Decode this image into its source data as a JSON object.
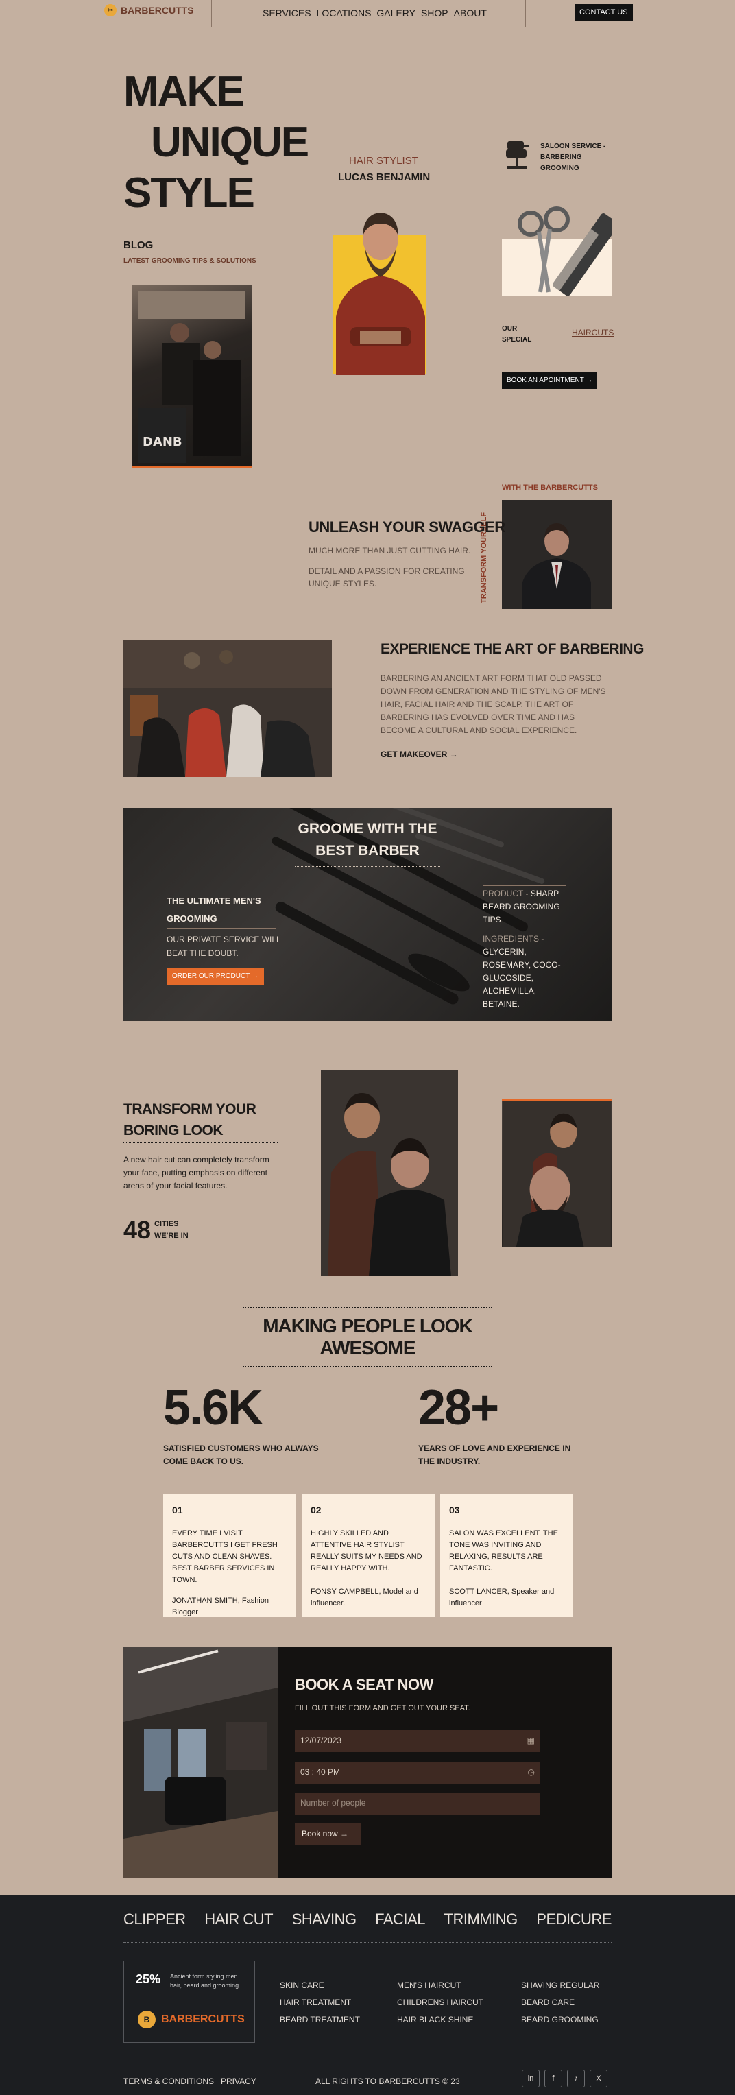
{
  "nav": {
    "brand": "BARBERCUTTS",
    "links": [
      "SERVICES",
      "LOCATIONS",
      "GALERY",
      "SHOP",
      "ABOUT"
    ],
    "contact": "CONTACT US"
  },
  "hero": {
    "title_lines": [
      "MAKE",
      "UNIQUE",
      "STYLE"
    ],
    "blog_title": "BLOG",
    "blog_sub": "LATEST GROOMING TIPS & SOLUTIONS",
    "stylist_label": "HAIR STYLIST",
    "stylist_name": "LUCAS BENJAMIN",
    "service_text": [
      "SALOON SERVICE -",
      "BARBERING",
      "GROOMING"
    ],
    "our_special": [
      "OUR",
      "SPECIAL"
    ],
    "haircuts_link": "HAIRCUTS",
    "book_button": "BOOK AN APOINTMENT"
  },
  "swagger": {
    "tag": "WITH THE BARBERCUTTS",
    "vertical": "TRANSFORM YOURSELF",
    "title": "UNLEASH YOUR SWAGGER",
    "p1": "MUCH MORE THAN JUST CUTTING HAIR.",
    "p2": "DETAIL AND A PASSION FOR CREATING UNIQUE STYLES."
  },
  "art": {
    "title": "EXPERIENCE THE ART OF BARBERING",
    "body": "BARBERING AN ANCIENT ART FORM THAT OLD PASSED DOWN FROM GENERATION AND THE STYLING OF MEN'S HAIR, FACIAL HAIR AND THE SCALP. THE ART OF BARBERING HAS EVOLVED OVER TIME AND HAS BECOME A CULTURAL AND SOCIAL EXPERIENCE.",
    "cta": "GET MAKEOVER"
  },
  "groome": {
    "title": "GROOME WITH THE BEST BARBER",
    "left_heading": "THE ULTIMATE MEN'S GROOMING",
    "left_body": "OUR PRIVATE SERVICE WILL BEAT THE DOUBT.",
    "order_button": "ORDER OUR PRODUCT",
    "product_key": "PRODUCT - ",
    "product_val": "SHARP BEARD GROOMING TIPS",
    "ingredients_key": "INGREDIENTS - ",
    "ingredients_val": "GLYCERIN, ROSEMARY, COCO-GLUCOSIDE, ALCHEMILLA, BETAINE."
  },
  "transform": {
    "title": "TRANSFORM YOUR BORING LOOK",
    "body": "A new hair cut can completely transform your face, putting emphasis on different areas of your facial features.",
    "count": "48",
    "count_label": [
      "CITIES",
      "WE'RE IN"
    ]
  },
  "awesome": {
    "title": "MAKING PEOPLE LOOK AWESOME",
    "stats": [
      {
        "value": "5.6K",
        "label": "SATISFIED CUSTOMERS WHO ALWAYS COME BACK TO US."
      },
      {
        "value": "28+",
        "label": "YEARS OF LOVE AND EXPERIENCE IN THE INDUSTRY."
      }
    ],
    "testimonials": [
      {
        "n": "01",
        "quote": "EVERY TIME I VISIT BARBERCUTTS I GET FRESH CUTS AND CLEAN SHAVES. BEST BARBER SERVICES IN TOWN.",
        "author": "JONATHAN SMITH, Fashion Blogger"
      },
      {
        "n": "02",
        "quote": "HIGHLY SKILLED AND ATTENTIVE HAIR STYLIST REALLY SUITS MY NEEDS AND REALLY HAPPY WITH.",
        "author": "FONSY CAMPBELL, Model and influencer."
      },
      {
        "n": "03",
        "quote": "SALON WAS EXCELLENT. THE TONE WAS INVITING AND RELAXING, RESULTS ARE FANTASTIC.",
        "author": "SCOTT LANCER, Speaker and influencer"
      }
    ]
  },
  "booking": {
    "title": "BOOK A SEAT NOW",
    "subtitle": "FILL OUT THIS FORM AND GET OUT YOUR SEAT.",
    "date_value": "12/07/2023",
    "time_value": "03 : 40 PM",
    "people_placeholder": "Number of people",
    "submit": "Book now"
  },
  "footer": {
    "services": [
      "CLIPPER",
      "HAIR CUT",
      "SHAVING",
      "FACIAL",
      "TRIMMING",
      "PEDICURE"
    ],
    "promo_pct": "25%",
    "promo_text": "Ancient form styling men hair, beard and grooming",
    "brand": "BARBERCUTTS",
    "col1": [
      "SKIN CARE",
      "HAIR TREATMENT",
      "BEARD TREATMENT"
    ],
    "col2": [
      "MEN'S HAIRCUT",
      "CHILDRENS HAIRCUT",
      "HAIR BLACK SHINE"
    ],
    "col3": [
      "SHAVING REGULAR",
      "BEARD CARE",
      "BEARD GROOMING"
    ],
    "terms": "TERMS & CONDITIONS   PRIVACY",
    "rights": "ALL RIGHTS TO BARBERCUTTS © 23",
    "socials": [
      "in",
      "f",
      "♪",
      "X"
    ]
  },
  "colors": {
    "page_bg": "#c4b0a0",
    "accent": "#e46a2a",
    "dark": "#141211",
    "cream": "#fbeedf",
    "footer_bg": "#1c1e21",
    "brand_brown": "#6b3b2b"
  }
}
